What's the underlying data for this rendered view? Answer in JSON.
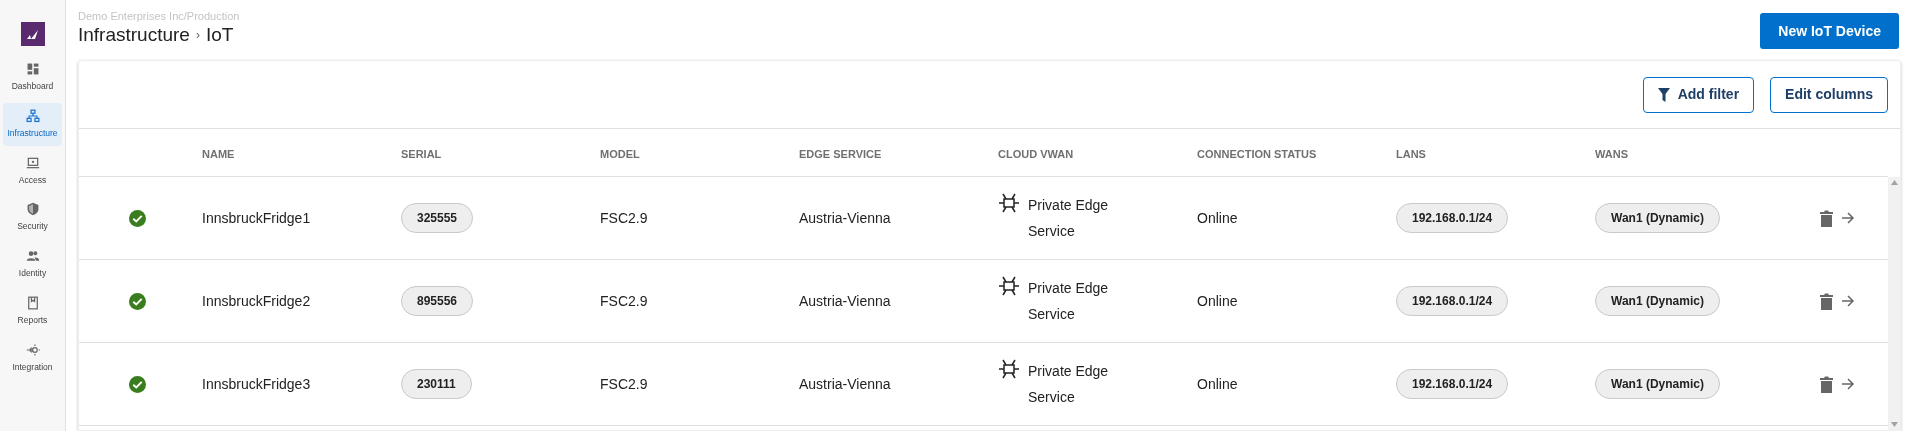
{
  "sidebar": {
    "items": [
      {
        "label": "Dashboard",
        "selected": false
      },
      {
        "label": "Infrastructure",
        "selected": true
      },
      {
        "label": "Access",
        "selected": false
      },
      {
        "label": "Security",
        "selected": false
      },
      {
        "label": "Identity",
        "selected": false
      },
      {
        "label": "Reports",
        "selected": false
      },
      {
        "label": "Integration",
        "selected": false
      }
    ]
  },
  "header": {
    "context": "Demo Enterprises Inc/Production",
    "breadcrumb": [
      "Infrastructure",
      "IoT"
    ],
    "separator": "›",
    "primary_button": "New IoT Device"
  },
  "toolbar": {
    "buttons": [
      {
        "label": "Add filter",
        "kind": "filter"
      },
      {
        "label": "Edit columns",
        "kind": "plain"
      }
    ]
  },
  "table": {
    "columns": [
      "NAME",
      "SERIAL",
      "MODEL",
      "EDGE SERVICE",
      "CLOUD VWAN",
      "CONNECTION STATUS",
      "LANS",
      "WANS"
    ],
    "rows": [
      {
        "healthy": true,
        "name": "InnsbruckFridge1",
        "serial": "325555",
        "model": "FSC2.9",
        "edge_service": "Austria-Vienna",
        "cloud_vwan": "Private Edge Service",
        "connection_status": "Online",
        "lans": "192.168.0.1/24",
        "wans": "Wan1 (Dynamic)"
      },
      {
        "healthy": true,
        "name": "InnsbruckFridge2",
        "serial": "895556",
        "model": "FSC2.9",
        "edge_service": "Austria-Vienna",
        "cloud_vwan": "Private Edge Service",
        "connection_status": "Online",
        "lans": "192.168.0.1/24",
        "wans": "Wan1 (Dynamic)"
      },
      {
        "healthy": true,
        "name": "InnsbruckFridge3",
        "serial": "230111",
        "model": "FSC2.9",
        "edge_service": "Austria-Vienna",
        "cloud_vwan": "Private Edge Service",
        "connection_status": "Online",
        "lans": "192.168.0.1/24",
        "wans": "Wan1 (Dynamic)"
      }
    ]
  }
}
